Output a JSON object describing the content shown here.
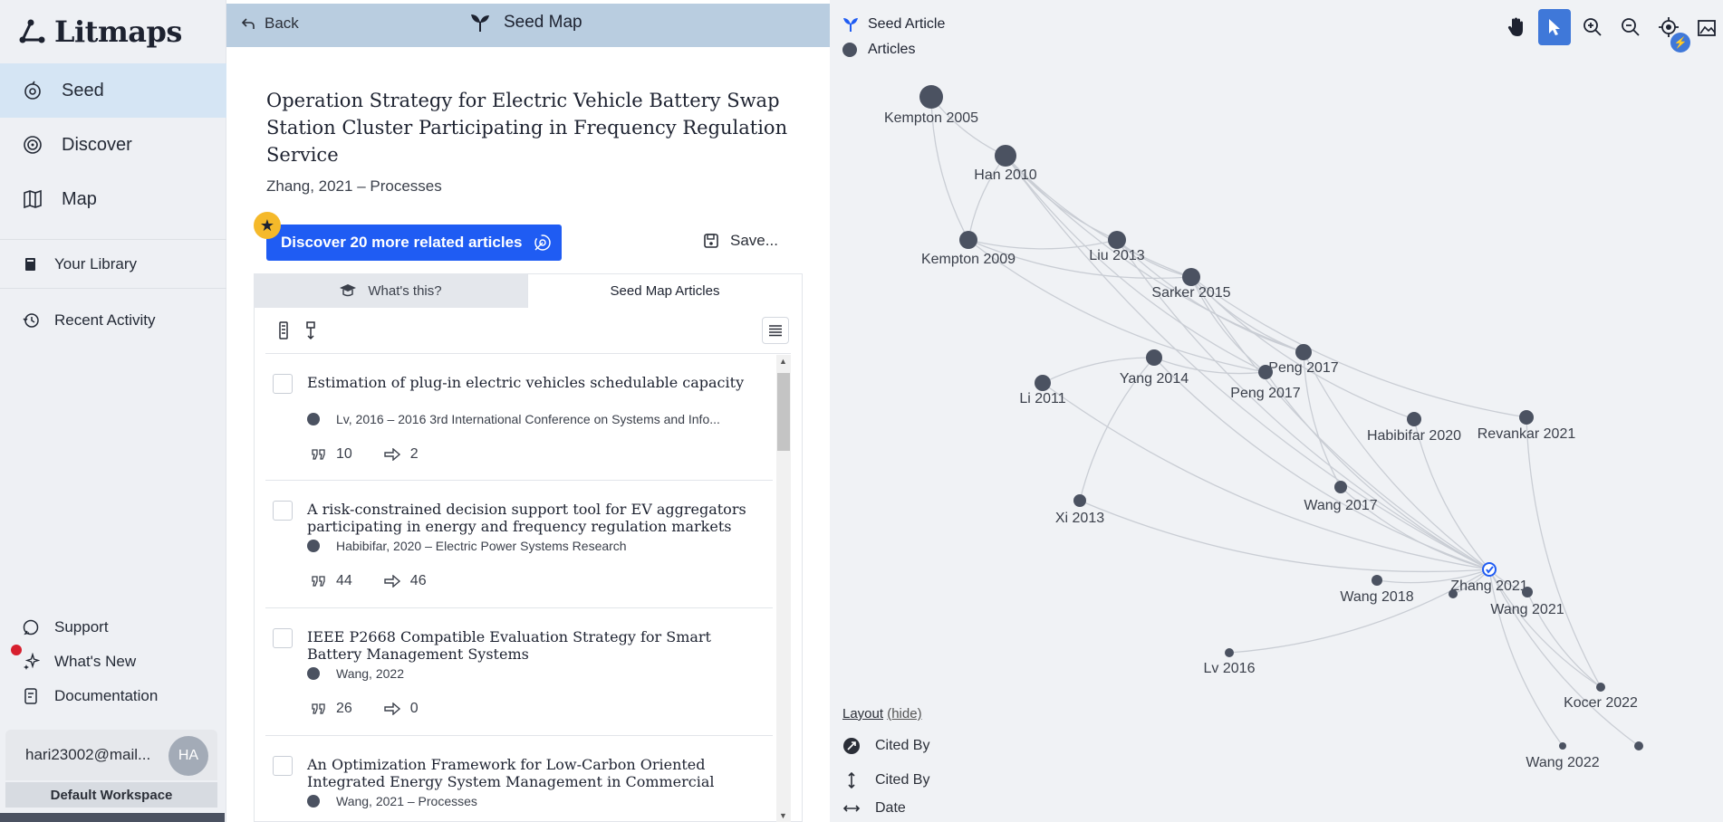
{
  "app": {
    "name": "Litmaps"
  },
  "sidebar": {
    "nav": [
      {
        "label": "Seed",
        "icon": "seed-icon",
        "active": true
      },
      {
        "label": "Discover",
        "icon": "discover-icon",
        "active": false
      },
      {
        "label": "Map",
        "icon": "map-icon",
        "active": false
      }
    ],
    "library": {
      "label": "Your Library"
    },
    "recent": {
      "label": "Recent Activity"
    },
    "support": {
      "label": "Support"
    },
    "whats_new": {
      "label": "What's New"
    },
    "documentation": {
      "label": "Documentation"
    },
    "account": {
      "email": "hari23002@mail...",
      "initials": "HA"
    },
    "workspace": "Default Workspace"
  },
  "panel": {
    "back_label": "Back",
    "title": "Seed Map",
    "article": {
      "title": "Operation Strategy for Electric Vehicle Battery Swap Station Cluster Participating in Frequency Regulation Service",
      "meta": "Zhang, 2021 – Processes"
    },
    "discover_label": "Discover 20 more related articles",
    "save_label": "Save...",
    "tabs": [
      {
        "label": "What's this?",
        "active": false
      },
      {
        "label": "Seed Map Articles",
        "active": true
      }
    ],
    "articles": [
      {
        "title": "Estimation of plug-in electric vehicles schedulable capacity",
        "meta": "Lv, 2016 – 2016 3rd International Conference on Systems and Info...",
        "citations": "10",
        "references": "2"
      },
      {
        "title": "A risk-constrained decision support tool for EV aggregators participating in energy and frequency regulation markets",
        "meta": "Habibifar, 2020 – Electric Power Systems Research",
        "citations": "44",
        "references": "46"
      },
      {
        "title": "IEEE P2668 Compatible Evaluation Strategy for Smart Battery Management Systems",
        "meta": "Wang, 2022",
        "citations": "26",
        "references": "0"
      },
      {
        "title": "An Optimization Framework for Low-Carbon Oriented Integrated Energy System Management in Commercial",
        "meta": "Wang, 2021 – Processes",
        "citations": "",
        "references": ""
      }
    ]
  },
  "map": {
    "legend": {
      "seed": "Seed Article",
      "articles": "Articles"
    },
    "colors": {
      "node": "#4b5261",
      "seed": "#1f5cf3",
      "edge": "#c9cdd4",
      "accent": "#3f78d9"
    },
    "nodes": [
      {
        "label": "Kempton 2005"
      },
      {
        "label": "Han 2010"
      },
      {
        "label": "Kempton 2009"
      },
      {
        "label": "Liu 2013"
      },
      {
        "label": "Sarker 2015"
      },
      {
        "label": "Yang 2014"
      },
      {
        "label": "Li 2011"
      },
      {
        "label": "Peng 2017"
      },
      {
        "label": "Peng 2017"
      },
      {
        "label": "Habibifar 2020"
      },
      {
        "label": "Revankar 2021"
      },
      {
        "label": "Xi 2013"
      },
      {
        "label": "Wang 2017"
      },
      {
        "label": "Zhang 2021"
      },
      {
        "label": "Wang 2018"
      },
      {
        "label": "Wang 2021"
      },
      {
        "label": "Lv 2016"
      },
      {
        "label": "Kocer 2022"
      },
      {
        "label": "Wang 2022"
      },
      {
        "label": ""
      },
      {
        "label": ""
      }
    ],
    "layout": {
      "title": "Layout",
      "hide": "(hide)",
      "rows": [
        {
          "label": "Cited By",
          "icon": "cited-by-icon"
        },
        {
          "label": "Cited By",
          "icon": "vertical-arrows-icon"
        },
        {
          "label": "Date",
          "icon": "horizontal-arrows-icon"
        }
      ]
    }
  }
}
